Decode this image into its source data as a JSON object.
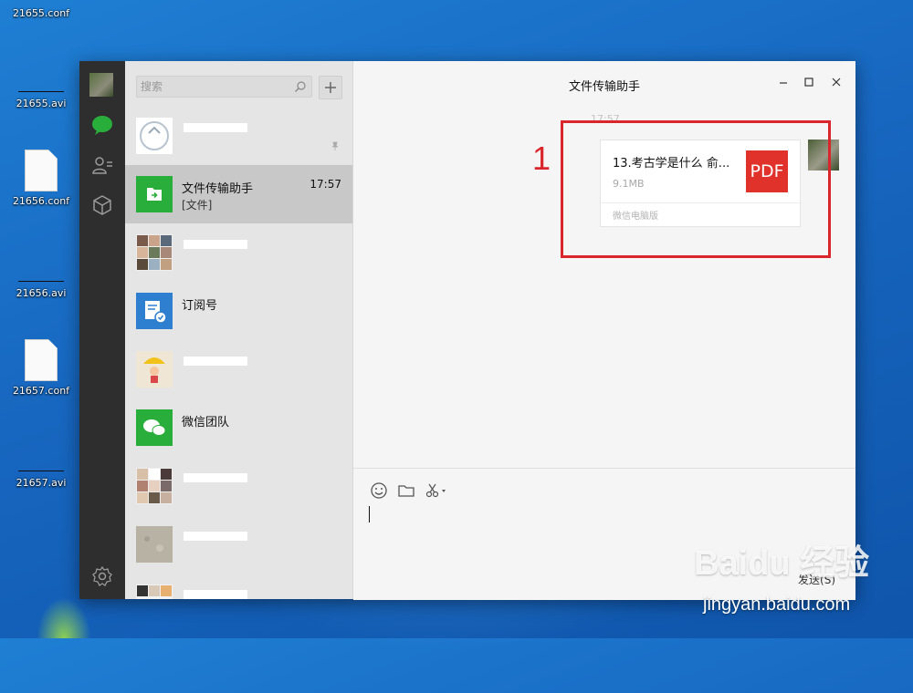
{
  "desktop": {
    "items": [
      {
        "label": "21655.conf",
        "kind": "file"
      },
      {
        "label": "21655.avi",
        "kind": "video"
      },
      {
        "label": "21656.conf",
        "kind": "file"
      },
      {
        "label": "21656.avi",
        "kind": "video"
      },
      {
        "label": "21657.conf",
        "kind": "file"
      },
      {
        "label": "21657.avi",
        "kind": "video"
      }
    ]
  },
  "sidebar": {
    "icons": [
      "avatar",
      "chat-icon",
      "contacts-icon",
      "box-icon",
      "settings-icon"
    ]
  },
  "search": {
    "placeholder": "搜索"
  },
  "chats": [
    {
      "name": "",
      "subtitle": "",
      "time": "",
      "pinned": true
    },
    {
      "name": "文件传输助手",
      "subtitle": "[文件]",
      "time": "17:57",
      "selected": true
    },
    {
      "name": "",
      "subtitle": "",
      "time": ""
    },
    {
      "name": "订阅号",
      "subtitle": "",
      "time": ""
    },
    {
      "name": "",
      "subtitle": "",
      "time": ""
    },
    {
      "name": "微信团队",
      "subtitle": "",
      "time": ""
    },
    {
      "name": "",
      "subtitle": "",
      "time": ""
    },
    {
      "name": "",
      "subtitle": "",
      "time": ""
    },
    {
      "name": "",
      "subtitle": "",
      "time": ""
    }
  ],
  "conversation": {
    "title": "文件传输助手",
    "message_time": "17:57",
    "file": {
      "name": "13.考古学是什么 俞...",
      "size": "9.1MB",
      "source": "微信电脑版",
      "type_badge": "PDF"
    },
    "annotation_number": "1",
    "send_label": "发送(S)"
  },
  "watermark": {
    "main": "Baidu 经验",
    "sub": "jingyan.baidu.com"
  },
  "colors": {
    "accent_green": "#2aae3b",
    "pdf_red": "#e0322a",
    "highlight_red": "#d9262c",
    "nav_bg": "#2e2e2e"
  }
}
